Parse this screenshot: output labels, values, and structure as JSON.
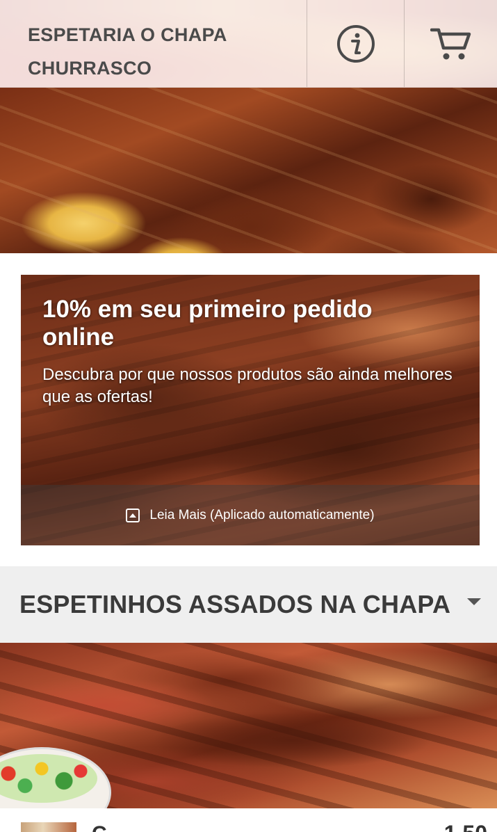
{
  "header": {
    "title_line1": "ESPETARIA O CHAPA",
    "title_line2": "CHURRASCO",
    "info_icon": "info-icon",
    "cart_icon": "cart-icon"
  },
  "promo": {
    "title": "10% em seu primeiro pedido online",
    "description": "Descubra por que nossos produtos são ainda melhores que as ofertas!",
    "read_more": "Leia Mais (Aplicado automaticamente)"
  },
  "category": {
    "title": "ESPETINHOS ASSADOS NA CHAPA"
  },
  "item": {
    "name_partial": "C",
    "price_partial": "1,50"
  },
  "colors": {
    "header_text": "#4a4a4a",
    "category_bg": "#efefef"
  }
}
